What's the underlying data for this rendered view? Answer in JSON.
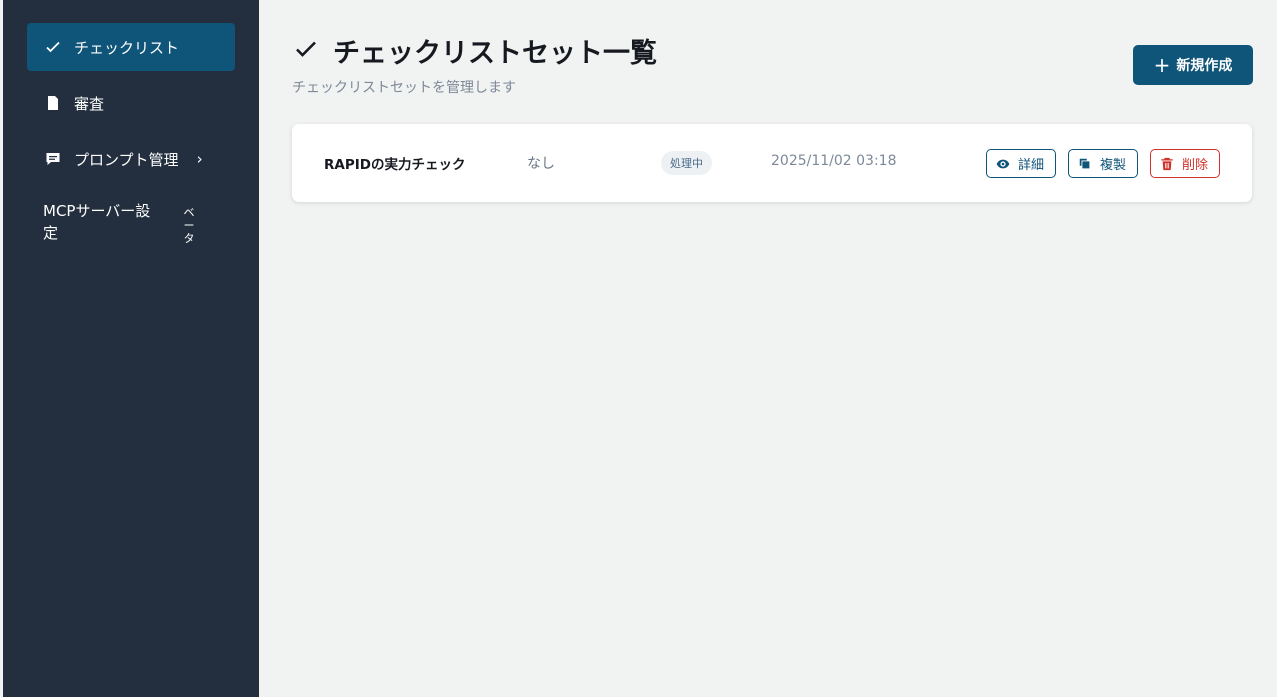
{
  "sidebar": {
    "items": [
      {
        "label": "チェックリスト",
        "icon": "check-icon",
        "active": true
      },
      {
        "label": "審査",
        "icon": "document-icon",
        "active": false
      },
      {
        "label": "プロンプト管理",
        "icon": "comment-icon",
        "active": false,
        "chevron": "›"
      }
    ],
    "mcp": {
      "label": "MCPサーバー設定",
      "badge": "ベータ"
    }
  },
  "header": {
    "title": "チェックリストセット一覧",
    "subtitle": "チェックリストセットを管理します",
    "new_button_label": "新規作成",
    "new_button_icon": "+"
  },
  "rows": [
    {
      "name": "RAPIDの実力チェック",
      "description": "なし",
      "status": "処理中",
      "date": "2025/11/02 03:18",
      "actions": {
        "detail": "詳細",
        "copy": "複製",
        "delete": "削除"
      }
    }
  ],
  "colors": {
    "sidebar_bg": "#232f3e",
    "accent": "#0f5479",
    "danger": "#d1312b",
    "page_bg": "#f1f2f2"
  }
}
